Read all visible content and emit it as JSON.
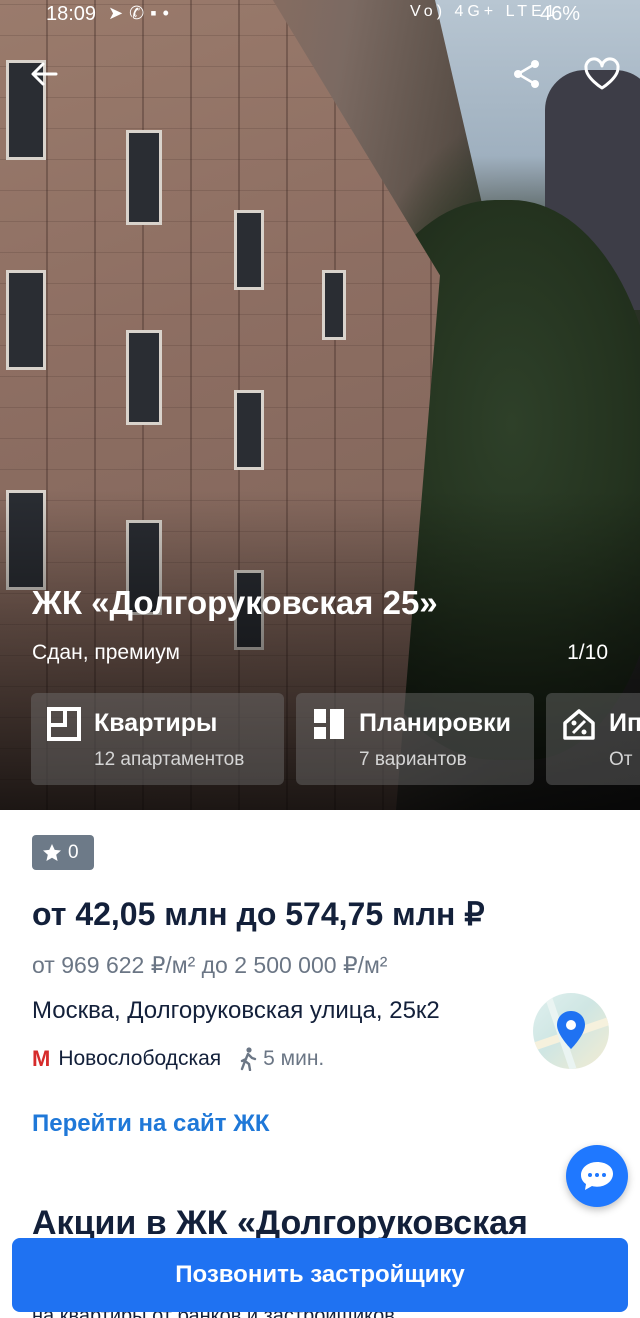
{
  "status_bar": {
    "time": "18:09",
    "left_icons": [
      "telegram-icon",
      "viber-icon",
      "message-icon",
      "dot-icon"
    ],
    "right_text": "Vo) 4G+ LTE1",
    "battery": "46%"
  },
  "hero": {
    "title": "ЖК «Долгоруковская 25»",
    "subtitle": "Сдан, премиум",
    "counter": "1/10",
    "cards": [
      {
        "icon": "apartments-icon",
        "title": "Квартиры",
        "subtitle": "12 апартаментов"
      },
      {
        "icon": "layouts-icon",
        "title": "Планировки",
        "subtitle": "7 вариантов"
      },
      {
        "icon": "mortgage-icon",
        "title": "Ип",
        "subtitle": "От"
      }
    ]
  },
  "rating": {
    "value": "0"
  },
  "price_range": "от 42,05 млн до 574,75 млн ₽",
  "price_per_m2": "от 969 622 ₽/м² до 2 500 000 ₽/м²",
  "address": "Москва, Долгоруковская улица, 25к2",
  "metro": {
    "logo": "М",
    "station": "Новослободская",
    "walk_time": "5 мин."
  },
  "site_link": "Перейти на сайт ЖК",
  "promo_heading": "Акции в ЖК «Долгоруковская",
  "promo_sub": "на квартиры от банков и застройщиков",
  "call_button": "Позвонить застройщику",
  "colors": {
    "primary": "#1f72f2",
    "link": "#1f78d8",
    "metro_red": "#d62b2b"
  }
}
